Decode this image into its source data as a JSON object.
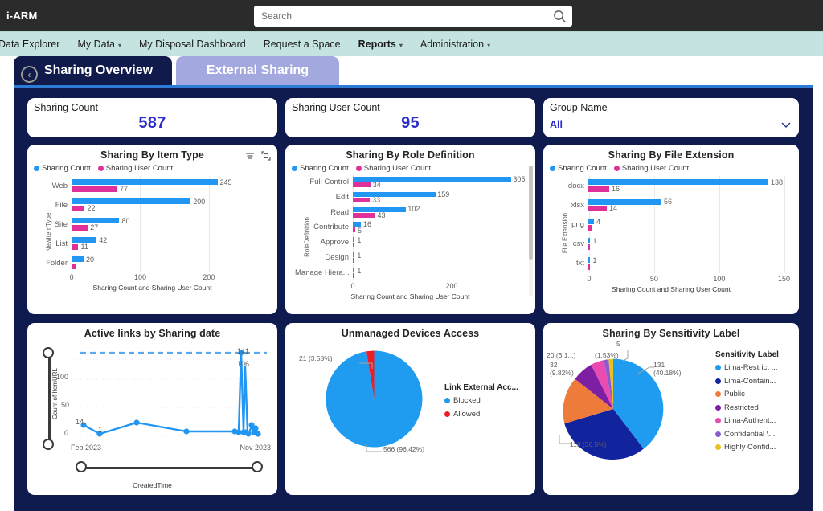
{
  "topbar": {
    "brand": "i-ARM",
    "search_placeholder": "Search",
    "search_value": "",
    "search_icon": "search-icon"
  },
  "nav": {
    "items": [
      {
        "label": "Data Explorer",
        "has_caret": false,
        "active": false
      },
      {
        "label": "My Data",
        "has_caret": true,
        "active": false
      },
      {
        "label": "My Disposal Dashboard",
        "has_caret": false,
        "active": false
      },
      {
        "label": "Request a Space",
        "has_caret": false,
        "active": false
      },
      {
        "label": "Reports",
        "has_caret": true,
        "active": true
      },
      {
        "label": "Administration",
        "has_caret": true,
        "active": false
      }
    ]
  },
  "tabs": {
    "back_icon": "back-arrow-icon",
    "items": [
      {
        "label": "Sharing Overview",
        "selected": true
      },
      {
        "label": "External Sharing",
        "selected": false
      }
    ]
  },
  "kpis": [
    {
      "title": "Sharing Count",
      "value": "587"
    },
    {
      "title": "Sharing User Count",
      "value": "95"
    }
  ],
  "slicer": {
    "title": "Group Name",
    "value": "All",
    "chevron_icon": "chevron-down-icon"
  },
  "colors": {
    "canvas": "#0f1a4f",
    "accent_blue": "#2196f3",
    "accent_pink": "#e0319b",
    "kpi_value": "#2c2ccd",
    "nav_bg": "#c5e3e0",
    "tab_active": "#101a4b",
    "tab_inactive": "#a3a9de",
    "allowed_red": "#ee1c25"
  },
  "card_icons": {
    "filter": "filter-icon",
    "focus": "focus-mode-icon"
  },
  "chart_data": [
    {
      "type": "bar",
      "title": "Sharing By Item Type",
      "orientation": "horizontal",
      "xlabel": "Sharing Count and Sharing User Count",
      "ylabel": "NewItemType",
      "categories": [
        "Web",
        "File",
        "Site",
        "List",
        "Folder"
      ],
      "series": [
        {
          "name": "Sharing Count",
          "color": "#2196f3",
          "values": [
            245,
            200,
            80,
            42,
            20
          ],
          "labels": [
            "245",
            "200",
            "80",
            "42",
            "20"
          ]
        },
        {
          "name": "Sharing User Count",
          "color": "#e0319b",
          "values": [
            77,
            22,
            27,
            11,
            7
          ],
          "labels": [
            "77",
            "22",
            "27",
            "11",
            ""
          ]
        }
      ],
      "xlim": [
        0,
        260
      ],
      "xticks": [
        0,
        100,
        200
      ],
      "xticklabels": [
        "0",
        "100",
        "200"
      ],
      "grid": true,
      "legend_position": "top-left"
    },
    {
      "type": "bar",
      "title": "Sharing By Role Definition",
      "orientation": "horizontal",
      "xlabel": "Sharing Count and Sharing User Count",
      "ylabel": "RoleDefinition",
      "categories": [
        "Full Control",
        "Edit",
        "Read",
        "Contribute",
        "Approve",
        "Design",
        "Manage Hiera..."
      ],
      "series": [
        {
          "name": "Sharing Count",
          "color": "#2196f3",
          "values": [
            305,
            159,
            102,
            16,
            1,
            1,
            1
          ],
          "labels": [
            "305",
            "159",
            "102",
            "16",
            "1",
            "1",
            "1"
          ]
        },
        {
          "name": "Sharing User Count",
          "color": "#e0319b",
          "values": [
            34,
            33,
            43,
            5,
            1,
            1,
            1
          ],
          "labels": [
            "34",
            "33",
            "43",
            "5",
            "",
            "",
            ""
          ]
        }
      ],
      "xlim": [
        0,
        330
      ],
      "xticks": [
        0,
        200
      ],
      "xticklabels": [
        "0",
        "200"
      ],
      "grid": true,
      "legend_position": "top-left",
      "has_scrollbar": true
    },
    {
      "type": "bar",
      "title": "Sharing By File Extension",
      "orientation": "horizontal",
      "xlabel": "Sharing Count and Sharing User Count",
      "ylabel": "File Extension",
      "categories": [
        "docx",
        "xlsx",
        "png",
        "csv",
        "txt"
      ],
      "series": [
        {
          "name": "Sharing Count",
          "color": "#2196f3",
          "values": [
            138,
            56,
            4,
            1,
            1
          ],
          "labels": [
            "138",
            "56",
            "4",
            "1",
            "1"
          ]
        },
        {
          "name": "Sharing User Count",
          "color": "#e0319b",
          "values": [
            16,
            14,
            3,
            1,
            1
          ],
          "labels": [
            "16",
            "14",
            "",
            "",
            ""
          ]
        }
      ],
      "xlim": [
        0,
        150
      ],
      "xticks": [
        0,
        50,
        100,
        150
      ],
      "xticklabels": [
        "0",
        "50",
        "100",
        "150"
      ],
      "grid": true,
      "legend_position": "top-left"
    },
    {
      "type": "line",
      "title": "Active links by Sharing date",
      "xlabel": "CreatedTime",
      "ylabel": "Count of ItemURL",
      "yticks": [
        0,
        50,
        100
      ],
      "yticklabels": [
        "0",
        "50",
        "100"
      ],
      "xticklabels": [
        "Feb 2023",
        "Nov 2023"
      ],
      "ylim": [
        0,
        145
      ],
      "grid": true,
      "series_color": "#2196f3",
      "constant_line": {
        "value": 141,
        "style": "dashed",
        "color": "#5aa9f0"
      },
      "point_labels": [
        {
          "x": "Feb 2023",
          "value": 14,
          "label": "14"
        },
        {
          "x": "Mar 2023",
          "value": 1,
          "label": "1"
        },
        {
          "x": "Nov 2023 peak",
          "value": 141,
          "label": "141"
        },
        {
          "x": "Nov 2023",
          "value": 106,
          "label": "106"
        }
      ],
      "points": [
        14,
        1,
        7,
        5,
        5,
        5,
        141,
        5,
        106,
        3,
        20,
        14,
        5
      ]
    },
    {
      "type": "pie",
      "title": "Unmanaged Devices Access",
      "legend_title": "Link External Acc...",
      "labels": [
        "Blocked",
        "Allowed"
      ],
      "values": [
        566,
        21
      ],
      "percentages": [
        "96.42%",
        "3.58%"
      ],
      "data_labels": [
        "566 (96.42%)",
        "21 (3.58%)"
      ],
      "colors": [
        "#1f9cf0",
        "#ee1c25"
      ],
      "legend_position": "right"
    },
    {
      "type": "pie",
      "title": "Sharing By Sensitivity Label",
      "legend_title": "Sensitivity Label",
      "labels": [
        "Lima-Restrict ...",
        "Lima-Contain...",
        "Public",
        "Restricted",
        "Lima-Authent...",
        "Confidential \\...",
        "Highly Confid..."
      ],
      "values": [
        131,
        119,
        32,
        20,
        5,
        2,
        2
      ],
      "percentages": [
        "40.18%",
        "36.5%",
        "9.82%",
        "6.1...",
        "1.53%",
        "",
        ""
      ],
      "data_labels": [
        "131 (40.18%)",
        "119 (36.5%)",
        "32 (9.82%)",
        "20 (6.1...)",
        "(1.53%)",
        "5",
        ""
      ],
      "colors": [
        "#1f9cf0",
        "#12239e",
        "#ef7b3b",
        "#7d1fa3",
        "#e94bb0",
        "#8a5ccf",
        "#e8c21f"
      ],
      "legend_position": "right"
    }
  ]
}
